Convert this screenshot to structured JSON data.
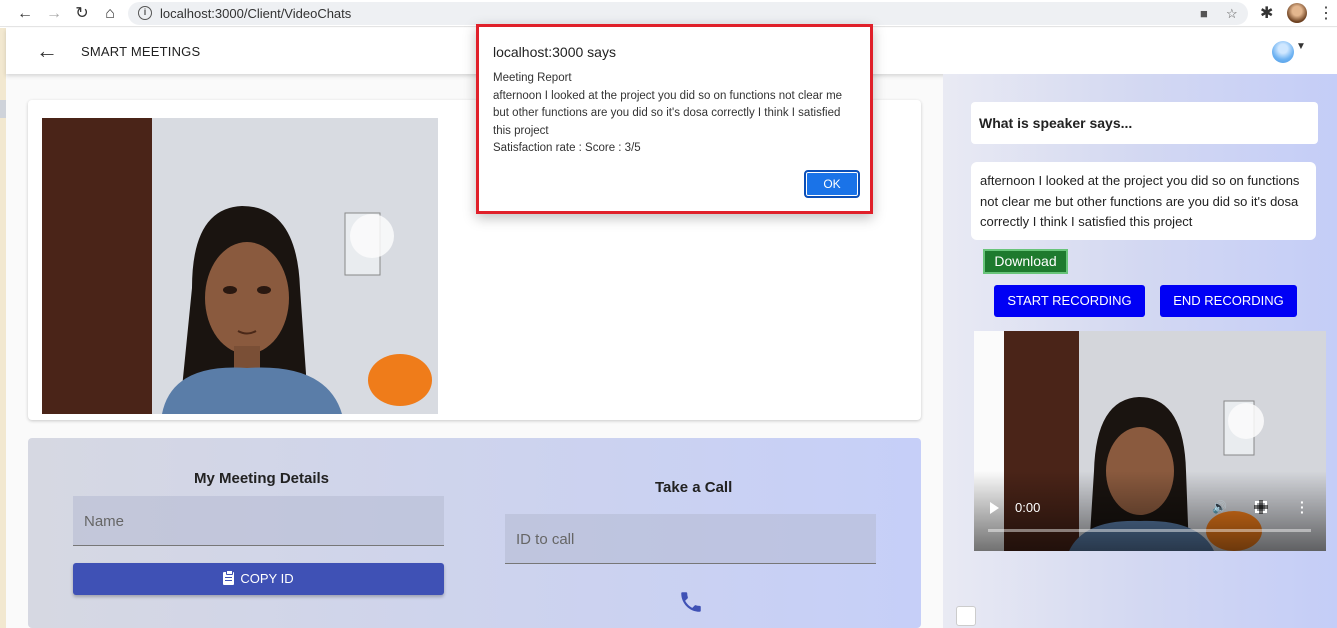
{
  "browser": {
    "url": "localhost:3000/Client/VideoChats",
    "icons": [
      "back-arrow",
      "forward-arrow",
      "reload",
      "home",
      "info",
      "camera",
      "star",
      "extensions",
      "profile",
      "menu"
    ]
  },
  "appbar": {
    "title": "SMART MEETINGS",
    "back_icon": "arrow-left"
  },
  "dialog": {
    "origin": "localhost:3000 says",
    "heading": "Meeting Report",
    "message": "afternoon I looked at the project you did so on functions not clear me but other functions are you did so it's dosa correctly I think I satisfied this project",
    "score_line": "Satisfaction rate : Score : 3/5",
    "ok_label": "OK",
    "highlight_color": "#e0202a"
  },
  "meeting_details": {
    "title": "My Meeting Details",
    "name_placeholder": "Name",
    "copy_label": "COPY ID"
  },
  "call": {
    "title": "Take a Call",
    "id_placeholder": "ID to call"
  },
  "speaker": {
    "title": "What is speaker says...",
    "transcript": "afternoon I looked at the project you did so on functions not clear me but other functions are you did so it's dosa correctly I think I satisfied this project",
    "download_label": "Download",
    "start_label": "START RECORDING",
    "end_label": "END RECORDING"
  },
  "player": {
    "time": "0:00"
  },
  "colors": {
    "primary": "#3f51b5",
    "record_button": "#0000f5",
    "download": "#1e7a2e",
    "ok_button": "#1a73e8"
  }
}
